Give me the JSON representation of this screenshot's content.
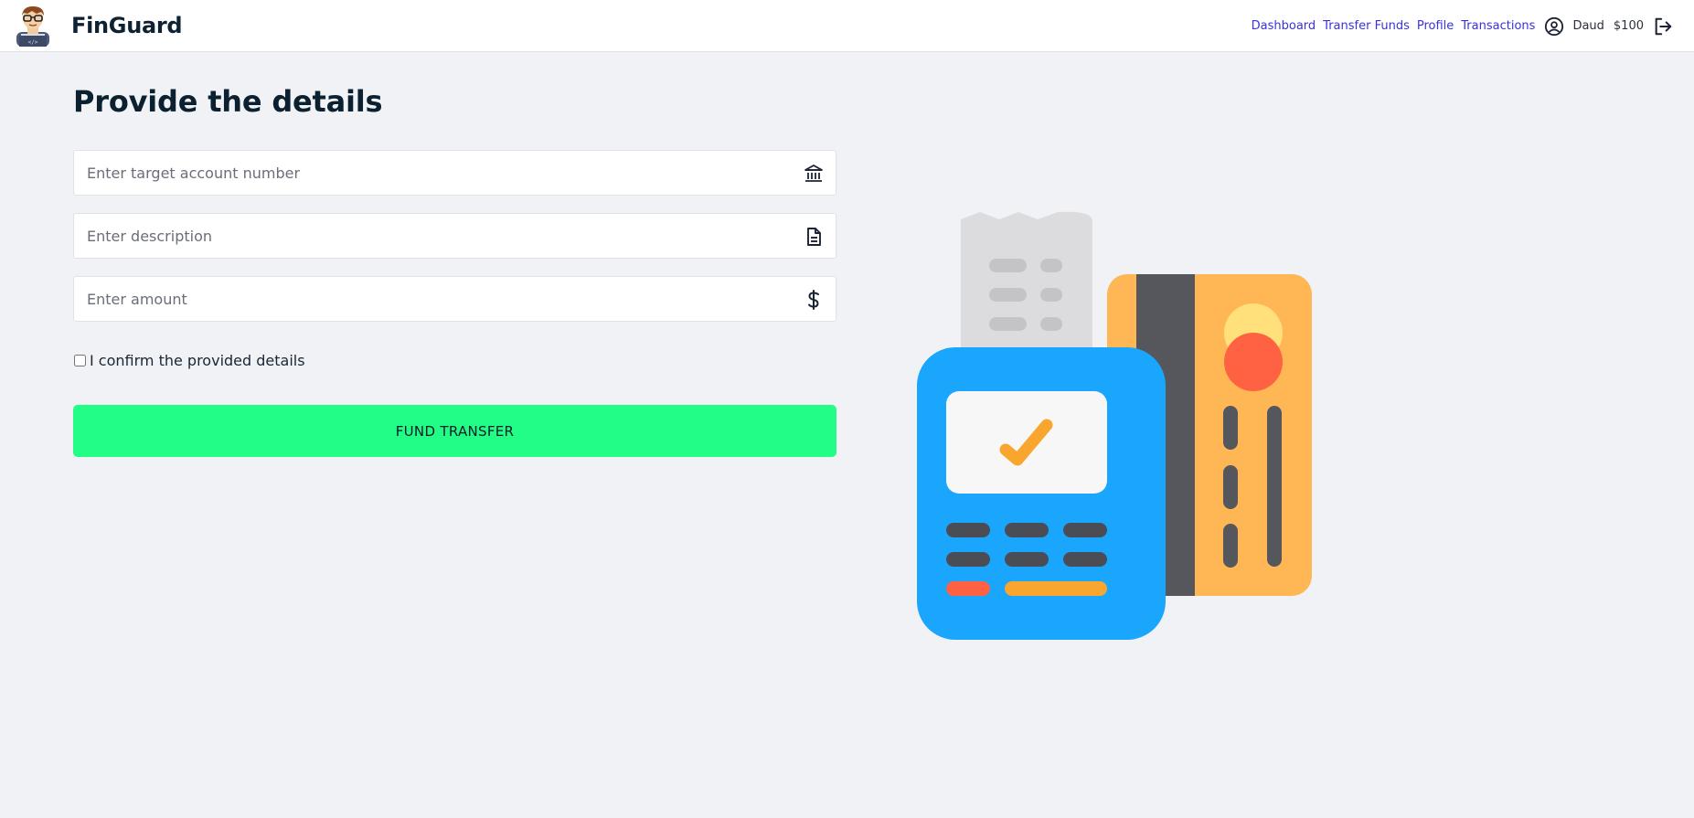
{
  "header": {
    "brand": "FinGuard",
    "nav": [
      {
        "label": "Dashboard"
      },
      {
        "label": "Transfer Funds"
      },
      {
        "label": "Profile"
      },
      {
        "label": "Transactions"
      }
    ],
    "user_name": "Daud",
    "balance": "$100",
    "icons": {
      "logo": "developer-avatar-logo",
      "user": "user-circle-icon",
      "logout": "logout-icon"
    }
  },
  "form": {
    "title": "Provide the details",
    "account_placeholder": "Enter target account number",
    "description_placeholder": "Enter description",
    "amount_placeholder": "Enter amount",
    "confirm_label": "I confirm the provided details",
    "submit_label": "FUND TRANSFER",
    "icons": {
      "account": "bank-icon",
      "description": "document-icon",
      "amount": "dollar-icon"
    }
  },
  "colors": {
    "accent_button": "#22fd86",
    "nav_link": "#3a32d8",
    "terminal_blue": "#1ba6fd",
    "card_orange": "#ffb655"
  }
}
